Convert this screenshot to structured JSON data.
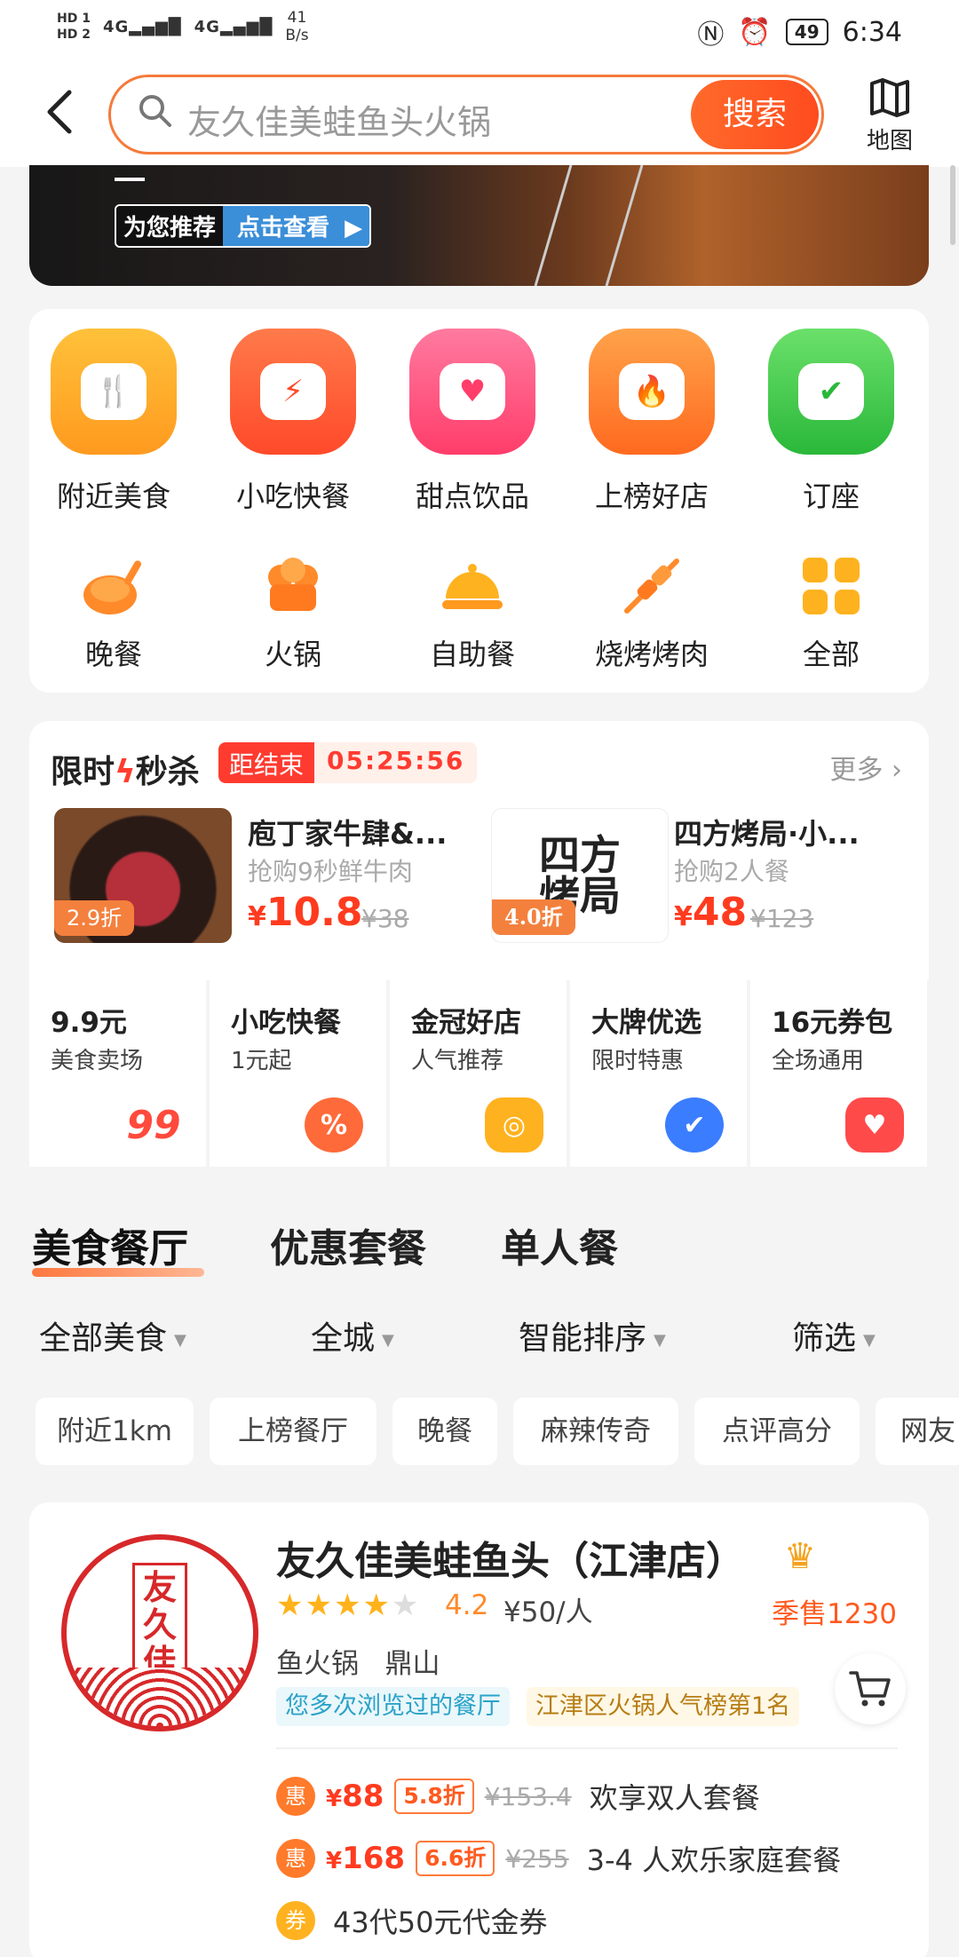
{
  "status": {
    "hd1": "HD 1",
    "hd2": "HD 2",
    "sig1": "4G",
    "sig2": "4G",
    "speed_value": "41",
    "speed_unit": "B/s",
    "battery": "49",
    "time": "6:34"
  },
  "search": {
    "placeholder": "友久佳美蛙鱼头火锅",
    "button": "搜索",
    "map_label": "地图"
  },
  "banner": {
    "tag1": "为您推荐",
    "tag2": "点击查看"
  },
  "categories_main": [
    {
      "label": "附近美食",
      "icon": "chef-hat-icon",
      "color": "#ffa91f"
    },
    {
      "label": "小吃快餐",
      "icon": "fries-icon",
      "color": "#ff5a2c"
    },
    {
      "label": "甜点饮品",
      "icon": "cup-icon",
      "color": "#ff4d7a"
    },
    {
      "label": "上榜好店",
      "icon": "flame-pot-icon",
      "color": "#ff7a1f"
    },
    {
      "label": "订座",
      "icon": "armchair-icon",
      "color": "#37c74b"
    }
  ],
  "categories_sub": [
    {
      "label": "晚餐",
      "icon": "roast-chicken-icon"
    },
    {
      "label": "火锅",
      "icon": "hotpot-icon"
    },
    {
      "label": "自助餐",
      "icon": "cloche-icon"
    },
    {
      "label": "烧烤烤肉",
      "icon": "skewer-icon"
    },
    {
      "label": "全部",
      "icon": "grid-icon"
    }
  ],
  "flash": {
    "title_a": "限时",
    "title_b": "秒杀",
    "countdown_label": "距结束",
    "countdown": "05:25:56",
    "more": "更多 ›",
    "deals": [
      {
        "name": "庖丁家牛肆&...",
        "sub": "抢购9秒鲜牛肉",
        "discount": "2.9折",
        "price": "10.8",
        "orig": "¥38"
      },
      {
        "name": "四方烤局·小...",
        "sub": "抢购2人餐",
        "discount": "4.0折",
        "price": "48",
        "orig": "¥123",
        "logo_text": "四方烤局"
      }
    ]
  },
  "promos": [
    {
      "title": "9.9元",
      "sub": "美食卖场",
      "icon": "99-icon",
      "color": "#ff4a3c"
    },
    {
      "title": "小吃快餐",
      "sub": "1元起",
      "icon": "percent-flower-icon",
      "color": "#ff6a3a"
    },
    {
      "title": "金冠好店",
      "sub": "人气推荐",
      "icon": "gold-ingot-icon",
      "color": "#ffb21f"
    },
    {
      "title": "大牌优选",
      "sub": "限时特惠",
      "icon": "check-shield-icon",
      "color": "#3b7dff"
    },
    {
      "title": "16元券包",
      "sub": "全场通用",
      "icon": "coupon-heart-icon",
      "color": "#ff4a4a"
    }
  ],
  "tabs": [
    "美食餐厅",
    "优惠套餐",
    "单人餐"
  ],
  "filters": [
    "全部美食",
    "全城",
    "智能排序",
    "筛选"
  ],
  "chips": [
    "附近1km",
    "上榜餐厅",
    "晚餐",
    "麻辣传奇",
    "点评高分",
    "网友"
  ],
  "restaurant": {
    "logo_text": "友久佳",
    "name": "友久佳美蛙鱼头（江津店）",
    "stars": 4.2,
    "rating": "4.2",
    "per_person": "¥50/人",
    "sales": "季售1230",
    "tags": "鱼火锅   鼎山",
    "label1": "您多次浏览过的餐厅",
    "label2": "江津区火锅人气榜第1名",
    "offers": [
      {
        "badge": "惠",
        "price": "88",
        "discount": "5.8折",
        "orig": "¥153.4",
        "desc": "欢享双人套餐"
      },
      {
        "badge": "惠",
        "price": "168",
        "discount": "6.6折",
        "orig": "¥255",
        "desc": "3-4 人欢乐家庭套餐"
      },
      {
        "badge": "券",
        "desc": "43代50元代金券"
      }
    ]
  }
}
